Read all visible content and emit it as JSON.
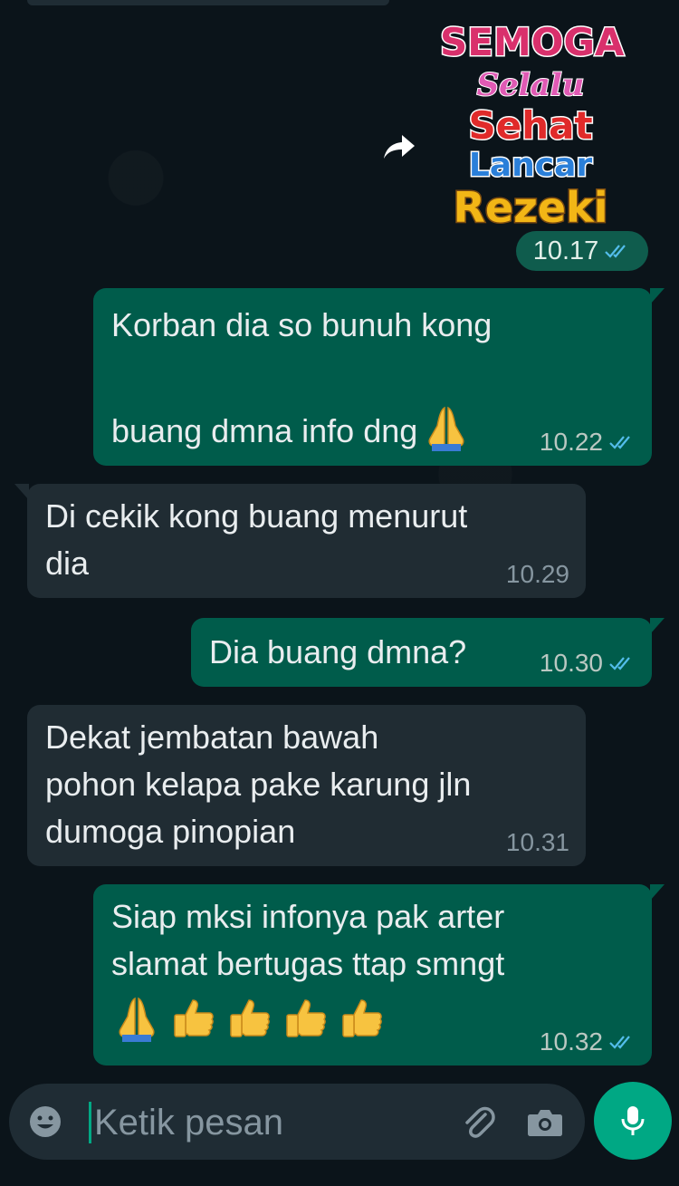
{
  "sticker": {
    "lines": [
      "SEMOGA",
      "Selalu",
      "Sehat",
      "Lancar",
      "Rezeki"
    ],
    "time": "10.17"
  },
  "messages": [
    {
      "direction": "out",
      "text": "Korban dia so bunuh kong\nbuang dmna info dng",
      "emoji": [
        "folded-hands"
      ],
      "time": "10.22",
      "status": "read"
    },
    {
      "direction": "in",
      "text": "Di cekik kong buang menurut\ndia",
      "time": "10.29"
    },
    {
      "direction": "out",
      "text": "Dia buang dmna?",
      "time": "10.30",
      "status": "read"
    },
    {
      "direction": "in",
      "text": "Dekat jembatan bawah\npohon kelapa pake karung jln\ndumoga pinopian",
      "time": "10.31"
    },
    {
      "direction": "out",
      "text": "Siap mksi infonya pak arter\nslamat bertugas ttap smngt",
      "emoji": [
        "folded-hands",
        "thumbs-up",
        "thumbs-up",
        "thumbs-up",
        "thumbs-up"
      ],
      "time": "10.32",
      "status": "read"
    }
  ],
  "composer": {
    "placeholder": "Ketik pesan",
    "icons": [
      "emoji-icon",
      "attach-icon",
      "camera-icon",
      "mic-icon"
    ]
  },
  "colors": {
    "background": "#0b141a",
    "outgoing_bubble": "#005c4b",
    "incoming_bubble": "#202c33",
    "accent": "#00a884",
    "read_ticks": "#53bdeb"
  }
}
